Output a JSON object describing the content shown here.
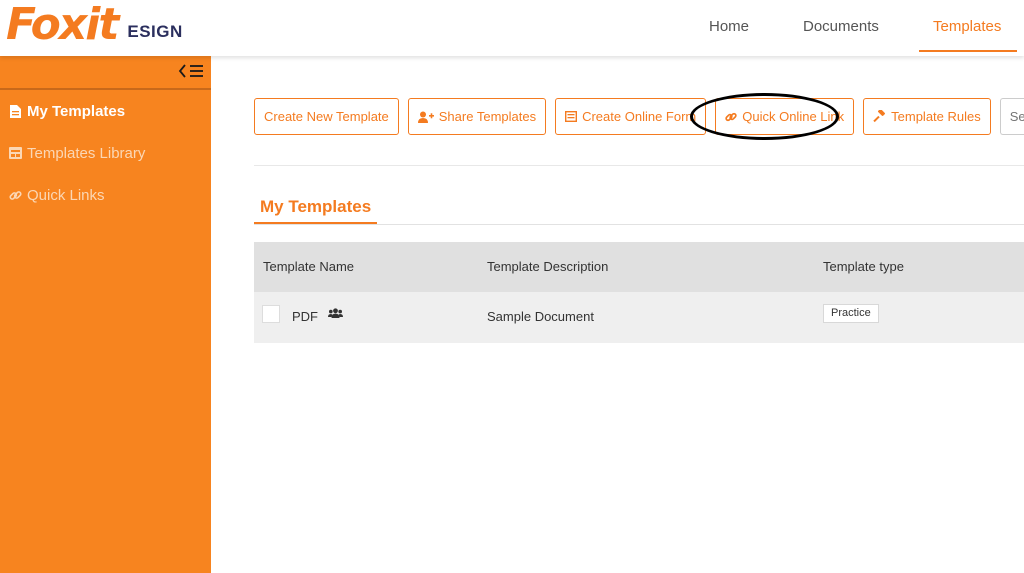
{
  "header": {
    "logo": "Foxit",
    "logo_sub": "ESIGN",
    "nav": [
      {
        "label": "Home"
      },
      {
        "label": "Documents"
      },
      {
        "label": "Templates",
        "active": true
      }
    ]
  },
  "sidebar": {
    "toggle_icon": "collapse-menu-icon",
    "items": [
      {
        "label": "My Templates",
        "icon": "file-icon",
        "active": true
      },
      {
        "label": "Templates Library",
        "icon": "library-icon",
        "active": false
      },
      {
        "label": "Quick Links",
        "icon": "link-icon",
        "active": false
      }
    ]
  },
  "toolbar": {
    "buttons": [
      {
        "label": "Create New Template",
        "icon": ""
      },
      {
        "label": "Share Templates",
        "icon": "user-plus-icon"
      },
      {
        "label": "Create Online Form",
        "icon": "form-icon"
      },
      {
        "label": "Quick Online Link",
        "icon": "link-icon",
        "highlighted": true
      },
      {
        "label": "Template Rules",
        "icon": "gavel-icon"
      }
    ],
    "search_placeholder": "Search Template"
  },
  "section": {
    "title": "My Templates"
  },
  "table": {
    "columns": [
      "Template Name",
      "Template Description",
      "Template type"
    ],
    "rows": [
      {
        "name": "PDF",
        "shared_icon": "users-icon",
        "description": "Sample Document",
        "type": "Practice"
      }
    ]
  },
  "colors": {
    "accent": "#f47b20",
    "sidebar": "#f7841f",
    "brand_dark": "#2b2f5e"
  }
}
